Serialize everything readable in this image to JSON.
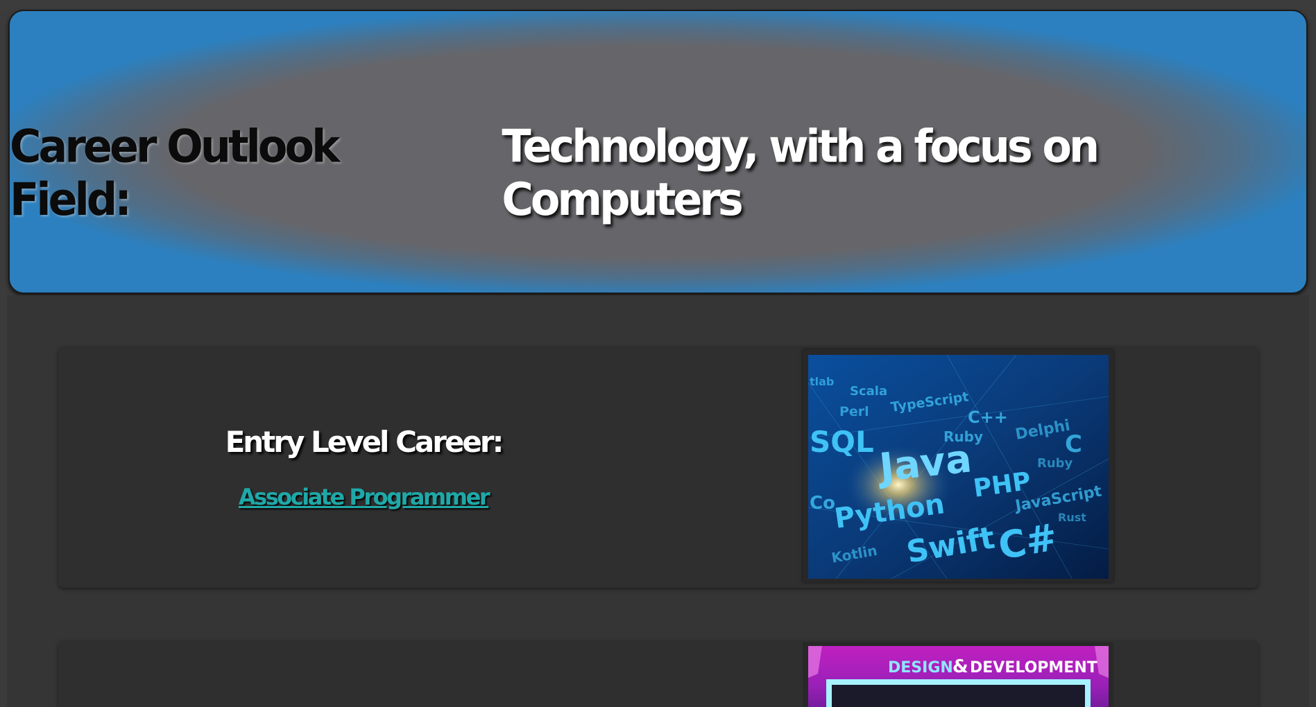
{
  "header": {
    "label": "Career Outlook Field:",
    "value": "Technology, with a focus on Computers"
  },
  "cards": [
    {
      "heading": "Entry Level Career:",
      "link_text": "Associate Programmer",
      "image": {
        "words": [
          "tlab",
          "Scala",
          "Perl",
          "TypeScript",
          "C++",
          "SQL",
          "Ruby",
          "Delphi",
          "C",
          "Java",
          "Ruby",
          "PHP",
          "Co",
          "Python",
          "JavaScript",
          "Rust",
          "Swift",
          "C#",
          "Kotlin"
        ]
      }
    },
    {
      "image": {
        "caption_left": "DESIGN",
        "caption_amp": "&",
        "caption_right": "DEVELOPMENT"
      }
    }
  ]
}
